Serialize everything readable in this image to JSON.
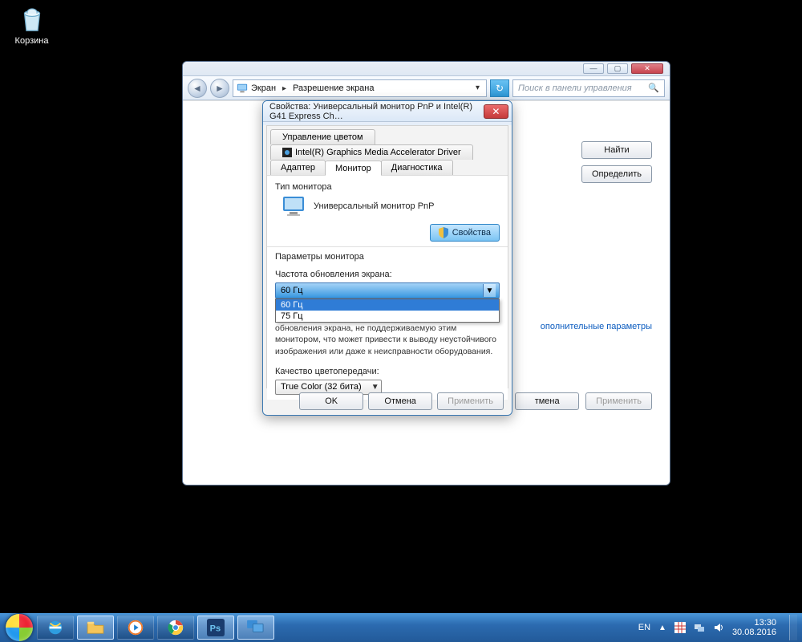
{
  "desktop": {
    "recycle_bin": "Корзина"
  },
  "cp": {
    "breadcrumb": {
      "root_icon": "monitor",
      "item1": "Экран",
      "item2": "Разрешение экрана"
    },
    "search_placeholder": "Поиск в панели управления",
    "buttons": {
      "find": "Найти",
      "identify": "Определить"
    },
    "link_advanced": "ополнительные параметры",
    "footer": {
      "cancel": "тмена",
      "apply": "Применить"
    }
  },
  "dialog": {
    "title": "Свойства: Универсальный монитор PnP и Intel(R) G41 Express Ch…",
    "tabs": {
      "color_mgmt": "Управление цветом",
      "intel_driver": "Intel(R) Graphics Media Accelerator Driver",
      "adapter": "Адаптер",
      "monitor": "Монитор",
      "diagnostics": "Диагностика"
    },
    "monitor_type_label": "Тип монитора",
    "monitor_name": "Универсальный монитор PnP",
    "properties_btn": "Свойства",
    "settings_label": "Параметры монитора",
    "refresh_label": "Частота обновления экрана:",
    "refresh_selected": "60 Гц",
    "refresh_options": [
      "60 Гц",
      "75 Гц"
    ],
    "note_text": "Снятие этого флажка позволяет выбрать частоту обновления экрана, не поддерживаемую этим монитором, что может привести к выводу неустойчивого изображения или даже к неисправности оборудования.",
    "color_quality_label": "Качество цветопередачи:",
    "color_quality_value": "True Color (32 бита)",
    "footer": {
      "ok": "OK",
      "cancel": "Отмена",
      "apply": "Применить"
    }
  },
  "taskbar": {
    "lang": "EN",
    "time": "13:30",
    "date": "30.08.2016"
  }
}
